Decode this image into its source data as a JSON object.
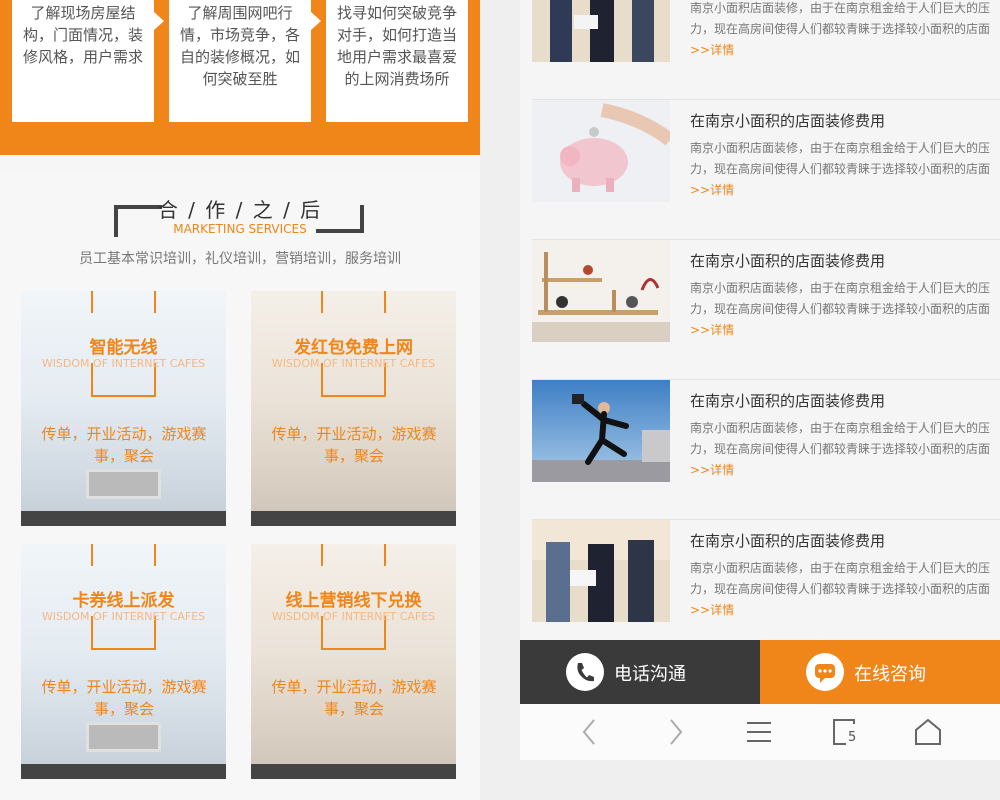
{
  "steps": [
    "了解现场房屋结构，门面情况，装修风格，用户需求",
    "了解周围网吧行情，市场竞争，各自的装修概况，如何突破至胜",
    "找寻如何突破竞争对手，如何打造当地用户需求最喜爱的上网消费场所"
  ],
  "cooperation": {
    "title": "合 / 作 / 之 / 后",
    "subtitle": "MARKETING SERVICES",
    "desc": "员工基本常识培训，礼仪培训，营销培训，服务培训",
    "features": [
      {
        "title": "智能无线",
        "sub": "WISDOM OF INTERNET CAFES",
        "desc": "传单，开业活动，游戏赛事，聚会"
      },
      {
        "title": "发红包免费上网",
        "sub": "WISDOM OF INTERNET CAFES",
        "desc": "传单，开业活动，游戏赛事，聚会"
      },
      {
        "title": "卡券线上派发",
        "sub": "WISDOM OF INTERNET CAFES",
        "desc": "传单，开业活动，游戏赛事，聚会"
      },
      {
        "title": "线上营销线下兑换",
        "sub": "WISDOM OF INTERNET CAFES",
        "desc": "传单，开业活动，游戏赛事，聚会"
      }
    ]
  },
  "news": [
    {
      "title": "",
      "desc": "南京小面积店面装修，由于在南京租金给于人们巨大的压力，现在高房间使得人们都较青睐于选择较小面积的店面",
      "more": ">>详情",
      "image": "business-people-image"
    },
    {
      "title": "在南京小面积的店面装修费用",
      "desc": "南京小面积店面装修，由于在南京租金给于人们巨大的压力，现在高房间使得人们都较青睐于选择较小面积的店面",
      "more": ">>详情",
      "image": "piggy-bank-image"
    },
    {
      "title": "在南京小面积的店面装修费用",
      "desc": "南京小面积店面装修，由于在南京租金给于人们巨大的压力，现在高房间使得人们都较青睐于选择较小面积的店面",
      "more": ">>详情",
      "image": "shelf-decor-image"
    },
    {
      "title": "在南京小面积的店面装修费用",
      "desc": "南京小面积店面装修，由于在南京租金给于人们巨大的压力，现在高房间使得人们都较青睐于选择较小面积的店面",
      "more": ">>详情",
      "image": "jumping-businessman-image"
    },
    {
      "title": "在南京小面积的店面装修费用",
      "desc": "南京小面积店面装修，由于在南京租金给于人们巨大的压力，现在高房间使得人们都较青睐于选择较小面积的店面",
      "more": ">>详情",
      "image": "business-people-image"
    }
  ],
  "contact": {
    "phone_label": "电话沟通",
    "online_label": "在线咨询"
  },
  "browser": {
    "back_icon": "chevron-left-icon",
    "forward_icon": "chevron-right-icon",
    "menu_icon": "hamburger-menu-icon",
    "tabs_icon": "tabs-icon",
    "tabs_count": "5",
    "home_icon": "home-icon"
  },
  "colors": {
    "accent": "#f08519",
    "dark": "#3a3a3a"
  }
}
